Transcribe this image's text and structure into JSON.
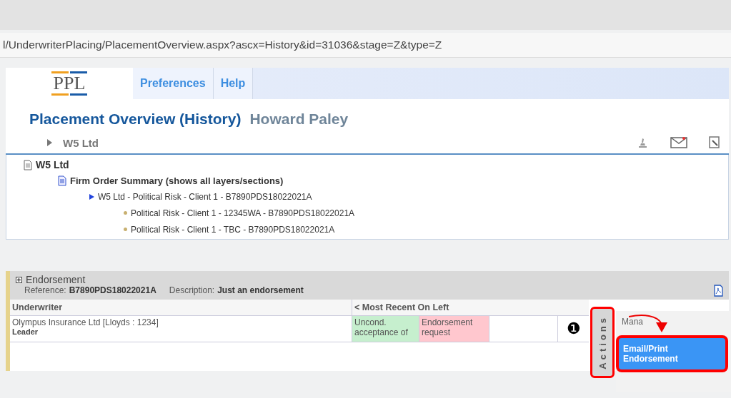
{
  "address_bar": {
    "url": "l/UnderwriterPlacing/PlacementOverview.aspx?ascx=History&id=31036&stage=Z&type=Z"
  },
  "header": {
    "logo": "PPL",
    "tabs": [
      {
        "label": "Preferences",
        "selected": false
      },
      {
        "label": "Help",
        "selected": false
      }
    ]
  },
  "page": {
    "title": "Placement Overview (History)",
    "user": "Howard Paley"
  },
  "client_bar": {
    "label": "W5 Ltd",
    "expanded": false
  },
  "tree": {
    "label": "W5 Ltd",
    "children": [
      {
        "label": "Firm Order Summary (shows all layers/sections)",
        "children": [
          {
            "label": "W5 Ltd - Political Risk - Client 1 - B7890PDS18022021A",
            "children": [
              {
                "label": "Political Risk - Client 1 - 12345WA - B7890PDS18022021A"
              },
              {
                "label": "Political Risk - Client 1 - TBC - B7890PDS18022021A"
              }
            ]
          }
        ]
      }
    ]
  },
  "endorsement": {
    "title": "Endorsement",
    "reference_label": "Reference:",
    "reference": "B7890PDS18022021A",
    "description_label": "Description:",
    "description": "Just an endorsement",
    "columns": [
      "Underwriter",
      "< Most Recent On Left"
    ],
    "rows": [
      {
        "underwriter": "Olympus Insurance Ltd [Lloyds : 1234]",
        "role": "Leader",
        "history": [
          {
            "text": "Uncond. acceptance of",
            "color": "#c6efce"
          },
          {
            "text": "Endorsement request",
            "color": "#ffc7ce"
          }
        ]
      }
    ]
  },
  "callout": "❶",
  "actions_tab": "Actions",
  "actions_menu": {
    "heading": "Mana",
    "items": [
      {
        "label": "Email/Print Endorsement",
        "selected": true
      }
    ]
  }
}
